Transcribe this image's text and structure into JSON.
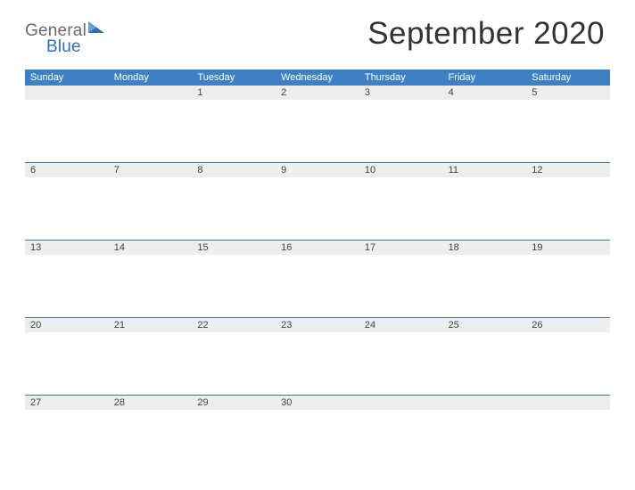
{
  "logo": {
    "part1": "General",
    "part2": "Blue"
  },
  "title": "September 2020",
  "day_names": [
    "Sunday",
    "Monday",
    "Tuesday",
    "Wednesday",
    "Thursday",
    "Friday",
    "Saturday"
  ],
  "weeks": [
    [
      "",
      "",
      "1",
      "2",
      "3",
      "4",
      "5"
    ],
    [
      "6",
      "7",
      "8",
      "9",
      "10",
      "11",
      "12"
    ],
    [
      "13",
      "14",
      "15",
      "16",
      "17",
      "18",
      "19"
    ],
    [
      "20",
      "21",
      "22",
      "23",
      "24",
      "25",
      "26"
    ],
    [
      "27",
      "28",
      "29",
      "30",
      "",
      "",
      ""
    ]
  ]
}
